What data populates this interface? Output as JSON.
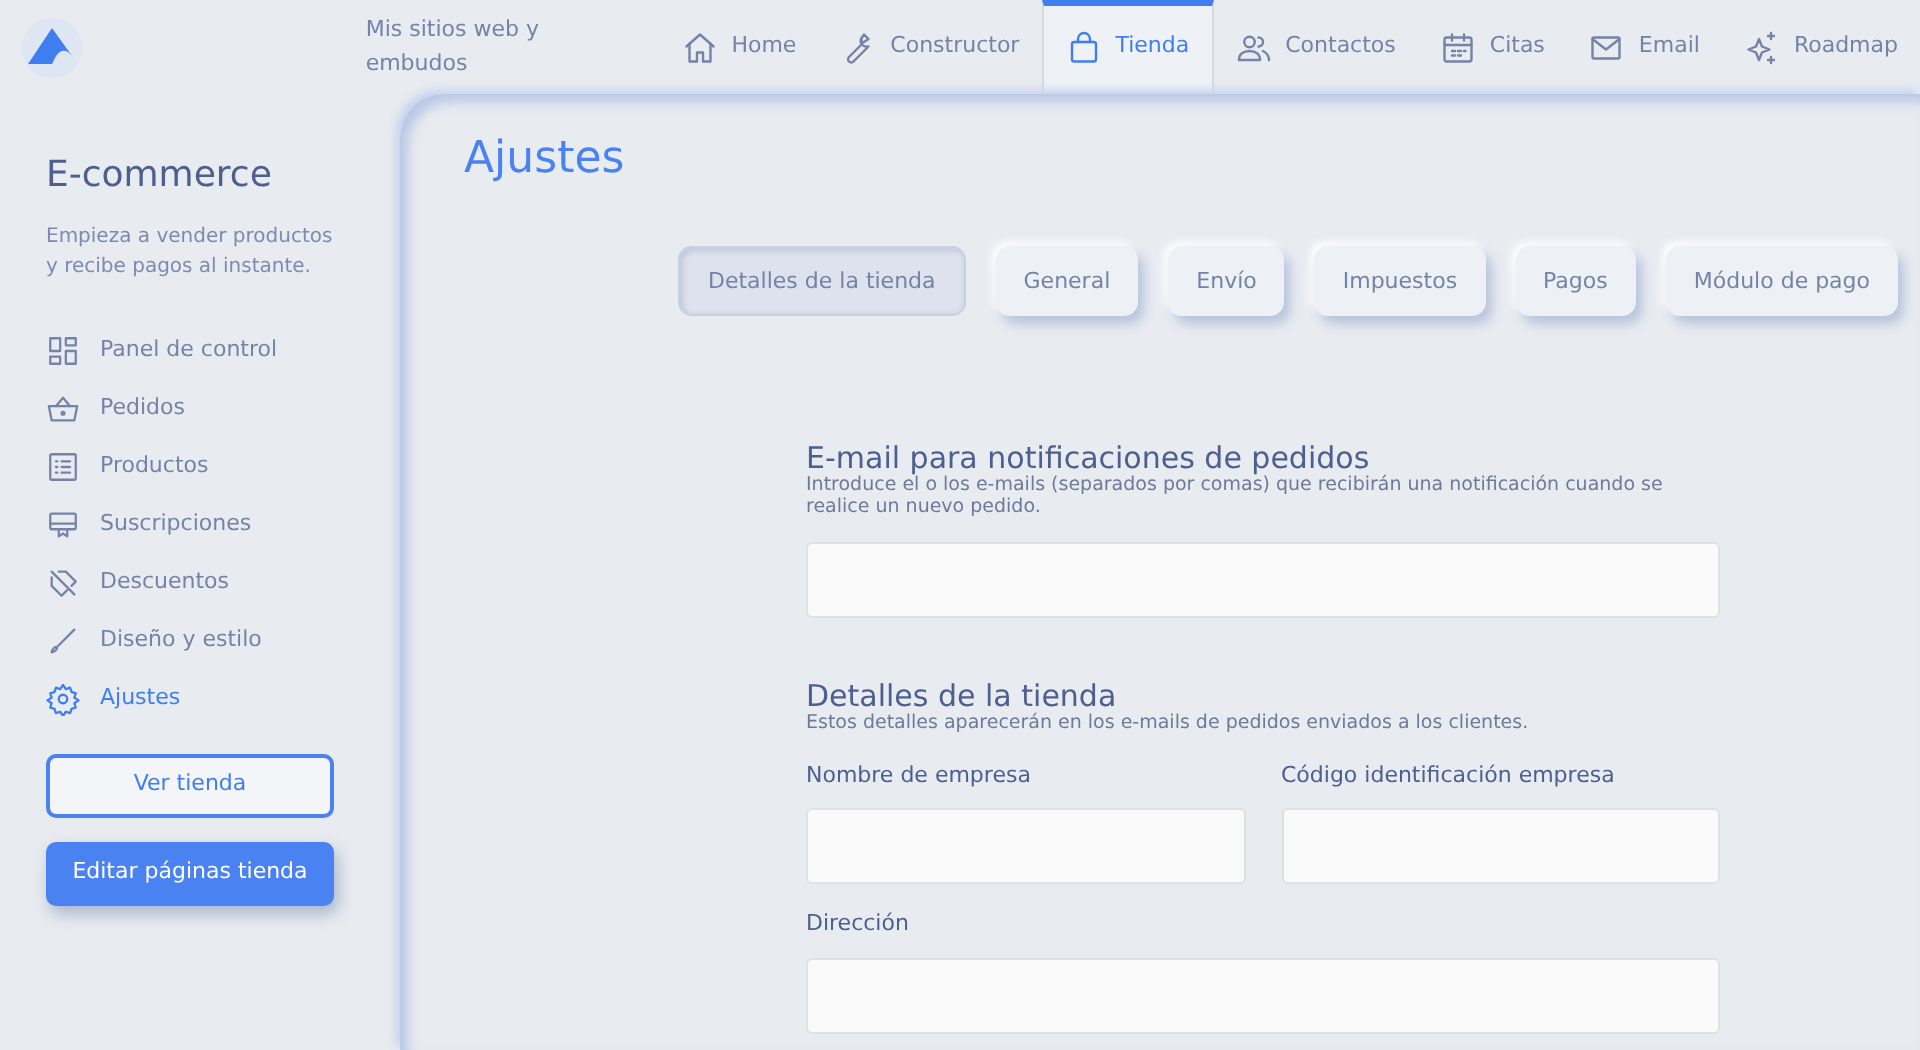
{
  "top_nav": {
    "items": [
      {
        "label": "Mis sitios web y embudos",
        "selected": false
      },
      {
        "label": "Home",
        "selected": false
      },
      {
        "label": "Constructor",
        "selected": false
      },
      {
        "label": "Tienda",
        "selected": true
      },
      {
        "label": "Contactos",
        "selected": false
      },
      {
        "label": "Citas",
        "selected": false
      },
      {
        "label": "Email",
        "selected": false
      },
      {
        "label": "Roadmap",
        "selected": false
      }
    ]
  },
  "sidebar": {
    "title": "E-commerce",
    "subtitle": "Empieza a vender productos y recibe pagos al instante.",
    "items": [
      {
        "label": "Panel de control",
        "selected": false
      },
      {
        "label": "Pedidos",
        "selected": false
      },
      {
        "label": "Productos",
        "selected": false
      },
      {
        "label": "Suscripciones",
        "selected": false
      },
      {
        "label": "Descuentos",
        "selected": false
      },
      {
        "label": "Diseño y estilo",
        "selected": false
      },
      {
        "label": "Ajustes",
        "selected": true
      }
    ],
    "buttons": [
      {
        "label": "Ver tienda",
        "kind": "outline"
      },
      {
        "label": "Editar páginas tienda",
        "kind": "solid"
      }
    ]
  },
  "main": {
    "title": "Ajustes",
    "tabs": [
      {
        "label": "Detalles de la tienda",
        "selected": true
      },
      {
        "label": "General",
        "selected": false
      },
      {
        "label": "Envío",
        "selected": false
      },
      {
        "label": "Impuestos",
        "selected": false
      },
      {
        "label": "Pagos",
        "selected": false
      },
      {
        "label": "Módulo de pago",
        "selected": false
      }
    ],
    "sections": [
      {
        "title": "E-mail para notificaciones de pedidos",
        "description": "Introduce el o los e-mails (separados por comas) que recibirán una notificación cuando se realice un nuevo pedido.",
        "rows": [
          [
            {}
          ]
        ]
      },
      {
        "title": "Detalles de la tienda",
        "description": "Estos detalles aparecerán en los e-mails de pedidos enviados a los clientes.",
        "rows": [
          [
            {
              "label": "Nombre de empresa"
            },
            {
              "label": "Código identificación empresa"
            }
          ],
          [
            {
              "label": "Dirección"
            }
          ]
        ]
      }
    ]
  }
}
